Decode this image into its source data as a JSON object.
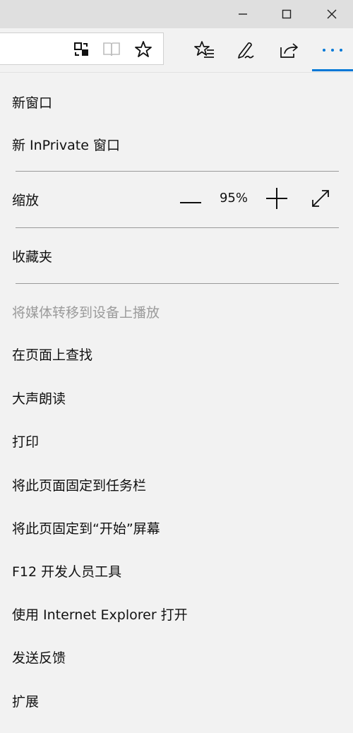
{
  "window": {
    "minimize_icon": "minimize-icon",
    "maximize_icon": "maximize-icon",
    "close_icon": "close-icon"
  },
  "toolbar": {
    "address_value": "",
    "icons": [
      "translate-icon",
      "reading-view-icon",
      "favorite-star-icon",
      "favorites-hub-icon",
      "web-note-pen-icon",
      "share-icon",
      "more-ellipsis-icon"
    ],
    "accent_color": "#0078d7"
  },
  "menu": {
    "new_window": "新窗口",
    "new_inprivate": "新 InPrivate 窗口",
    "zoom_label": "缩放",
    "zoom_value": "95%",
    "favorites": "收藏夹",
    "cast_media": "将媒体转移到设备上播放",
    "find_on_page": "在页面上查找",
    "read_aloud": "大声朗读",
    "print": "打印",
    "pin_to_taskbar": "将此页面固定到任务栏",
    "pin_to_start": "将此页固定到“开始”屏幕",
    "dev_tools": "F12 开发人员工具",
    "open_with_ie": "使用 Internet Explorer 打开",
    "send_feedback": "发送反馈",
    "extensions": "扩展"
  }
}
